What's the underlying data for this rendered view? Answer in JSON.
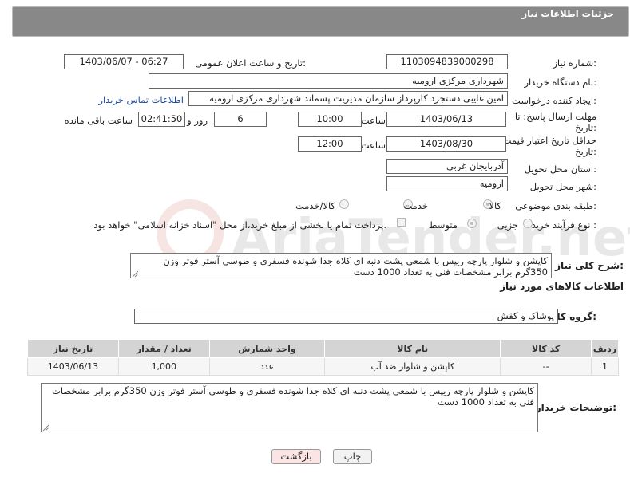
{
  "header": {
    "title": "جزئیات اطلاعات نیاز"
  },
  "watermark": {
    "text": "AriaTender.net"
  },
  "fields": {
    "need_number_label": "شماره نیاز:",
    "need_number": "1103094839000298",
    "announce_label": "تاریخ و ساعت اعلان عمومی:",
    "announce_value": "1403/06/07 - 06:27",
    "buyer_org_label": "نام دستگاه خریدار:",
    "buyer_org": "شهرداری مرکزی ارومیه",
    "creator_label": "ایجاد کننده درخواست:",
    "creator": "امین غایبی دستجرد کارپرداز سازمان مدیریت پسماند شهرداری مرکزی ارومیه",
    "contact_link": "اطلاعات تماس خریدار",
    "deadline_label_1": "مهلت ارسال پاسخ: تا",
    "deadline_label_2": "تاریخ:",
    "deadline_date": "1403/06/13",
    "time_label": "ساعت",
    "deadline_time": "10:00",
    "days": "6",
    "days_label": "روز و",
    "remaining": "02:41:50",
    "remaining_label": "ساعت باقی مانده",
    "validity_label_1": "حداقل تاریخ اعتبار قیمت: تا",
    "validity_label_2": "تاریخ:",
    "validity_date": "1403/08/30",
    "validity_time": "12:00",
    "province_label": "استان محل تحویل:",
    "province": "آذربایجان غربی",
    "city_label": "شهر محل تحویل:",
    "city": "ارومیه",
    "category_label": "طبقه بندی موضوعی:",
    "category_options": [
      "کالا",
      "خدمت",
      "کالا/خدمت"
    ],
    "process_label": "نوع فرآیند خرید :",
    "process_options": [
      "جزیی",
      "متوسط"
    ],
    "payment_text": "پرداخت تمام یا بخشی از مبلغ خرید،از محل \"اسناد خزانه اسلامی\" خواهد بود."
  },
  "description": {
    "label": "شرح کلی نیاز:",
    "text": "کاپشن و شلوار پارچه ریپس با شمعی پشت دنبه ای کلاه جدا شونده فسفری و طوسی آستر فوتر وزن 350گرم برابر مشخصات فنی به تعداد 1000 دست"
  },
  "goods": {
    "section_title": "اطلاعات کالاهای مورد نیاز",
    "group_label": "گروه کالا:",
    "group_value": "پوشاک و کفش",
    "columns": [
      "ردیف",
      "کد کالا",
      "نام کالا",
      "واحد شمارش",
      "تعداد / مقدار",
      "تاریخ نیاز"
    ],
    "rows": [
      {
        "row": "1",
        "code": "--",
        "name": "کاپشن و شلوار ضد آب",
        "unit": "عدد",
        "qty": "1,000",
        "date": "1403/06/13"
      }
    ]
  },
  "buyer_notes": {
    "label": "توضیحات خریدار:",
    "text": "کاپشن و شلوار پارچه ریپس با شمعی پشت دنبه ای کلاه جدا شونده فسفری و طوسی آستر فوتر وزن 350گرم برابر مشخصات فنی به تعداد 1000 دست"
  },
  "buttons": {
    "print": "چاپ",
    "back": "بازگشت"
  }
}
